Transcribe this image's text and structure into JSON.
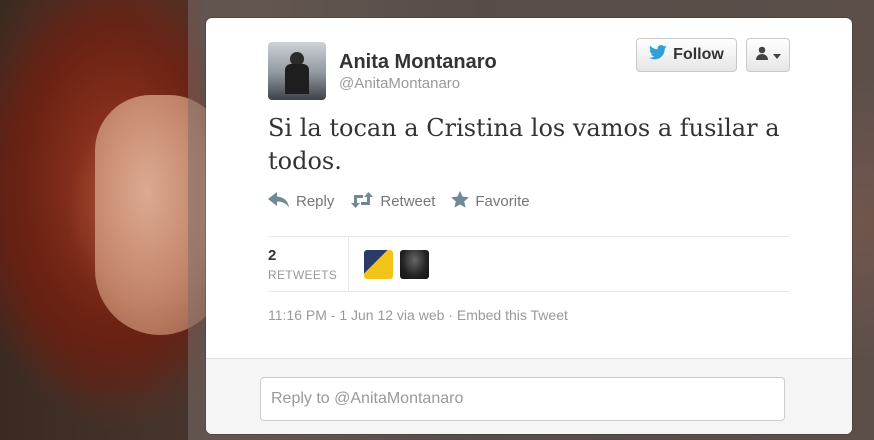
{
  "user": {
    "name": "Anita Montanaro",
    "handle": "@AnitaMontanaro"
  },
  "header": {
    "follow_label": "Follow"
  },
  "tweet": {
    "text": "Si la tocan a Cristina los vamos a fusilar a todos."
  },
  "actions": {
    "reply": "Reply",
    "retweet": "Retweet",
    "favorite": "Favorite"
  },
  "stats": {
    "retweet_count": "2",
    "retweet_label": "RETWEETS"
  },
  "meta": {
    "timestamp": "11:16 PM - 1 Jun 12 via web",
    "separator": "·",
    "embed_label": "Embed this Tweet"
  },
  "reply_box": {
    "placeholder": "Reply to @AnitaMontanaro"
  },
  "colors": {
    "twitter_blue": "#2fa0d8",
    "action_gray": "#6f8a96"
  },
  "icons": [
    "twitter-bird-icon",
    "person-icon",
    "chevron-down-icon",
    "reply-icon",
    "retweet-icon",
    "star-icon"
  ]
}
